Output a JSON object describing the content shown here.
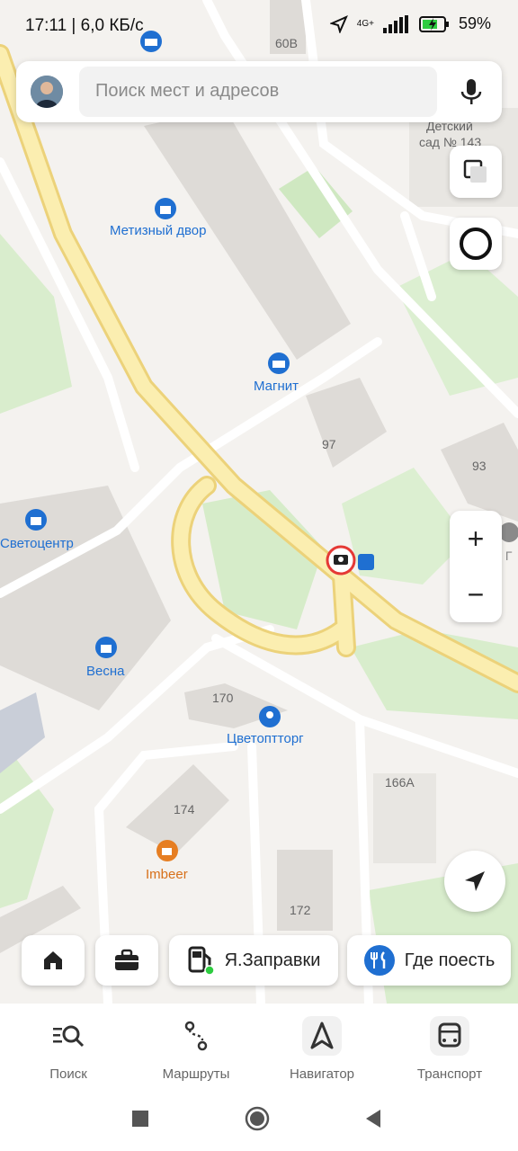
{
  "status_bar": {
    "time_speed": "17:11 | 6,0 КБ/с",
    "network": "4G+",
    "battery": "59%"
  },
  "search": {
    "placeholder": "Поиск мест и адресов"
  },
  "map_labels": {
    "metizny": "Метизный двор",
    "magnit": "Магнит",
    "svetocentr": "Светоцентр",
    "vesna": "Весна",
    "cvetopttorg": "Цветоптторг",
    "imbeer": "Imbeer",
    "kindergarten_line1": "Детский",
    "kindergarten_line2": "сад № 143",
    "mreo": "МРЭО Г",
    "h60v": "60В",
    "h97": "97",
    "h93": "93",
    "h170": "170",
    "h166a": "166А",
    "h174": "174",
    "h172": "172"
  },
  "chips": {
    "fuel": "Я.Заправки",
    "food": "Где поесть"
  },
  "bottom_nav": [
    {
      "label": "Поиск"
    },
    {
      "label": "Маршруты"
    },
    {
      "label": "Навигатор"
    },
    {
      "label": "Транспорт"
    }
  ],
  "colors": {
    "accent": "#1f6fd1",
    "road": "#f7e7a0",
    "park": "#d6ecc9",
    "building": "#dedbd7"
  }
}
